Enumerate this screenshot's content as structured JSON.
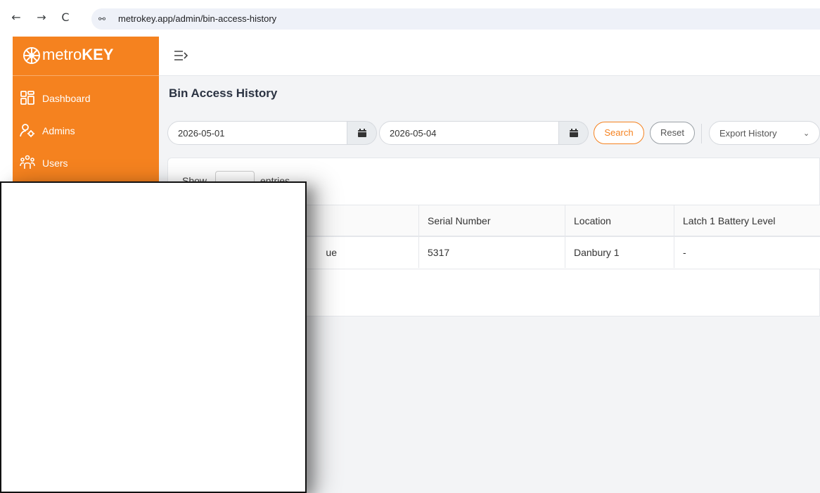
{
  "browser": {
    "back": "←",
    "forward": "→",
    "reload": "C",
    "site_icon": "⚯",
    "url": "metrokey.app/admin/bin-access-history"
  },
  "brand": {
    "name_light": "metro",
    "name_bold": "KEY",
    "logo_icon": "logo-icon"
  },
  "sidebar": {
    "items": [
      {
        "label": "Dashboard",
        "icon": "dashboard-icon"
      },
      {
        "label": "Admins",
        "icon": "admins-icon"
      },
      {
        "label": "Users",
        "icon": "users-icon"
      }
    ]
  },
  "page": {
    "title": "Bin Access History"
  },
  "filters": {
    "start_date": "2026-05-01",
    "end_date": "2026-05-04",
    "search_label": "Search",
    "reset_label": "Reset",
    "export_label": "Export History"
  },
  "table_controls": {
    "show_label": "Show",
    "entries_label": "entries"
  },
  "table": {
    "columns": [
      "Serial Number",
      "Location",
      "Latch 1 Battery Level"
    ],
    "rows": [
      {
        "partial": "ue",
        "serial": "5317",
        "location": "Danbury 1",
        "battery": "-"
      }
    ]
  },
  "colors": {
    "accent": "#f5821f",
    "background": "#f3f4f6"
  }
}
